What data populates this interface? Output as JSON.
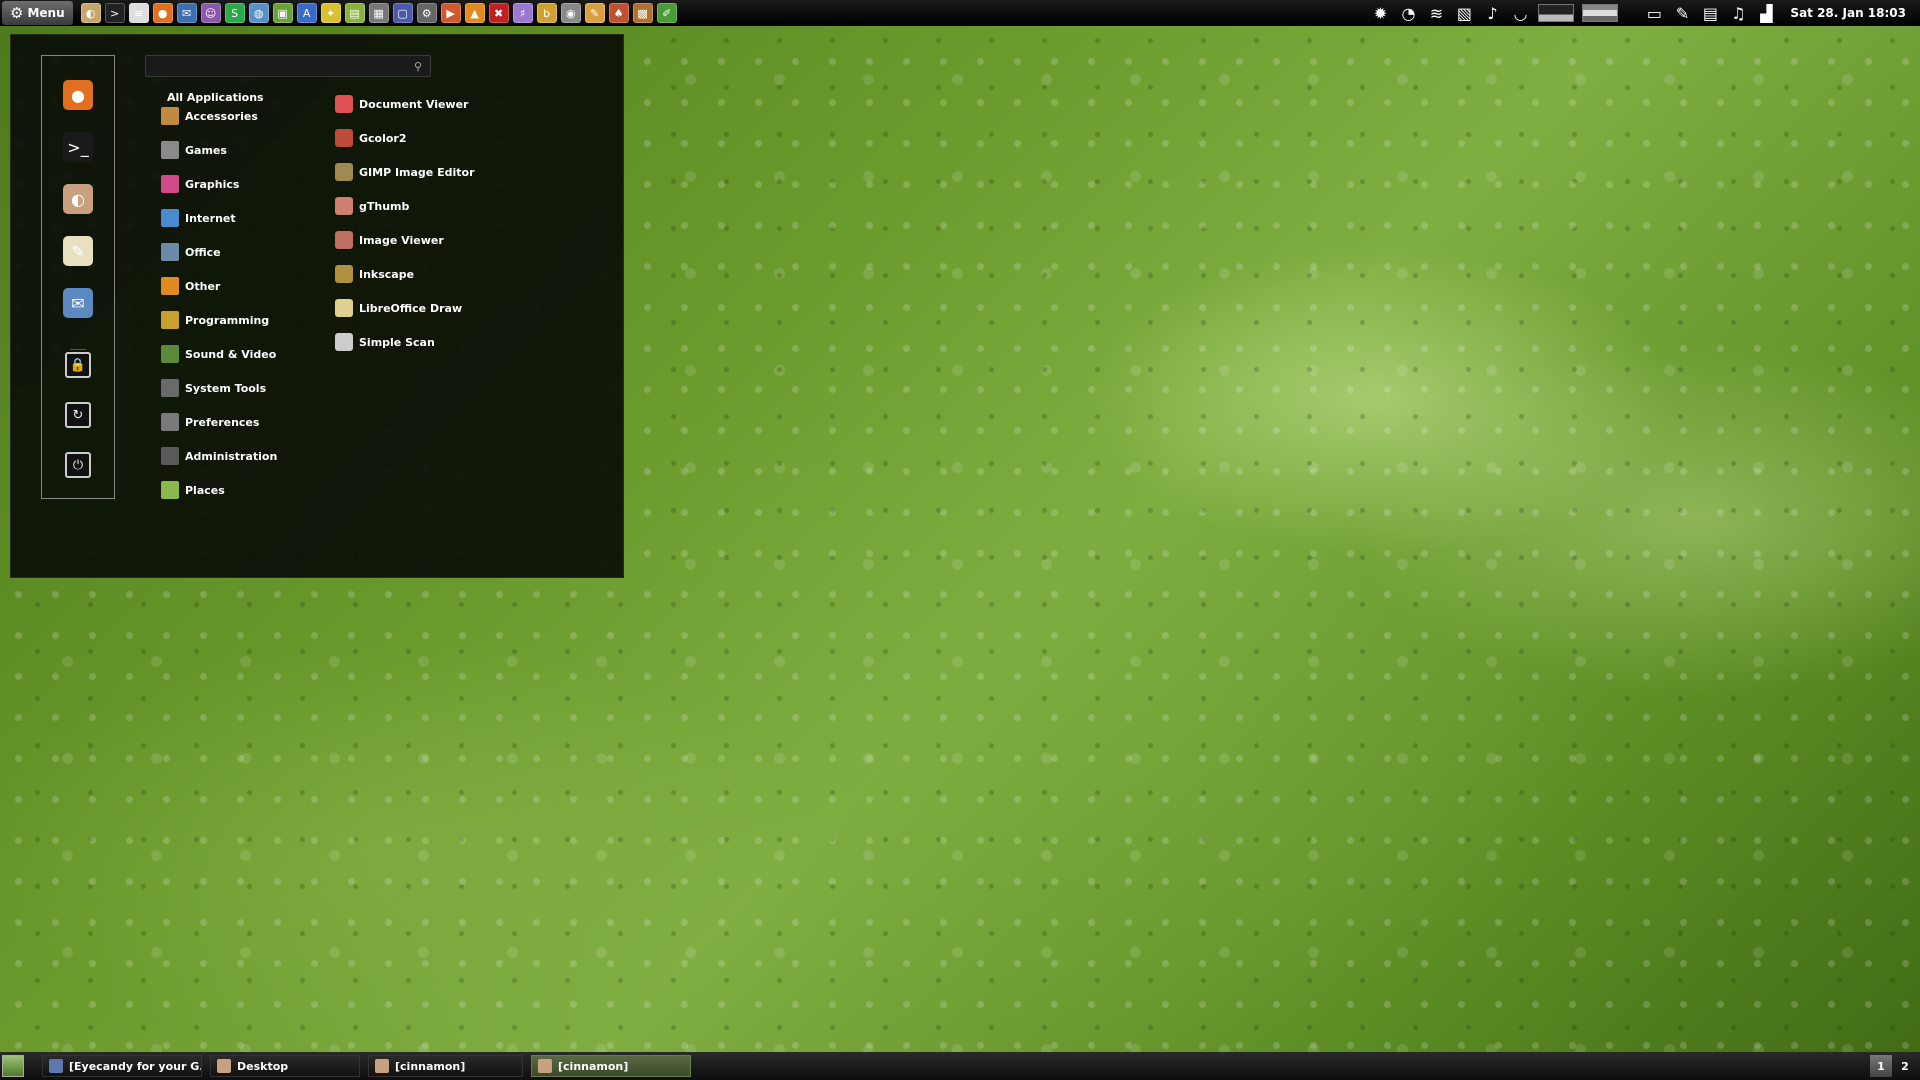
{
  "top_panel": {
    "menu_label": "Menu",
    "launchers": [
      {
        "icon": "file-manager-icon",
        "color": "#c9a66b",
        "glyph": "◐"
      },
      {
        "icon": "terminal-icon",
        "color": "#222222",
        "glyph": ">"
      },
      {
        "icon": "text-editor-icon",
        "color": "#dddddd",
        "glyph": "≡"
      },
      {
        "icon": "firefox-icon",
        "color": "#e07020",
        "glyph": "●"
      },
      {
        "icon": "thunderbird-icon",
        "color": "#3a6fb0",
        "glyph": "✉"
      },
      {
        "icon": "pidgin-icon",
        "color": "#8a5aa8",
        "glyph": "☺"
      },
      {
        "icon": "skype-icon",
        "color": "#2aa84a",
        "glyph": "S"
      },
      {
        "icon": "chat-icon",
        "color": "#5a8fc8",
        "glyph": "◍"
      },
      {
        "icon": "image-viewer-icon",
        "color": "#6aa03a",
        "glyph": "▣"
      },
      {
        "icon": "writer-icon",
        "color": "#3a6ac8",
        "glyph": "A"
      },
      {
        "icon": "star-icon",
        "color": "#d8c030",
        "glyph": "✦"
      },
      {
        "icon": "archive-icon",
        "color": "#8ab040",
        "glyph": "▤"
      },
      {
        "icon": "calculator-icon",
        "color": "#777777",
        "glyph": "▦"
      },
      {
        "icon": "monitor-icon",
        "color": "#4a5aa8",
        "glyph": "▢"
      },
      {
        "icon": "settings-icon",
        "color": "#666666",
        "glyph": "⚙"
      },
      {
        "icon": "media-player-icon",
        "color": "#d05a30",
        "glyph": "▶"
      },
      {
        "icon": "vlc-icon",
        "color": "#e08a20",
        "glyph": "▲"
      },
      {
        "icon": "video-editor-icon",
        "color": "#c02020",
        "glyph": "✖"
      },
      {
        "icon": "keyboard-icon",
        "color": "#9a7ad0",
        "glyph": "♯"
      },
      {
        "icon": "notes-icon",
        "color": "#d0a030",
        "glyph": "b"
      },
      {
        "icon": "eye-icon",
        "color": "#888888",
        "glyph": "◉"
      },
      {
        "icon": "gimp-icon",
        "color": "#d8a040",
        "glyph": "✎"
      },
      {
        "icon": "game-icon",
        "color": "#c05030",
        "glyph": "♠"
      },
      {
        "icon": "package-icon",
        "color": "#b07030",
        "glyph": "▩"
      },
      {
        "icon": "pen-icon",
        "color": "#4a9a3a",
        "glyph": "✐"
      }
    ],
    "tray": [
      {
        "icon": "gear-tray-icon",
        "glyph": "✹"
      },
      {
        "icon": "messenger-tray-icon",
        "glyph": "◔"
      },
      {
        "icon": "rss-tray-icon",
        "glyph": "≋"
      },
      {
        "icon": "feed-tray-icon",
        "glyph": "▧"
      },
      {
        "icon": "music-note-tray-icon",
        "glyph": "♪"
      },
      {
        "icon": "cup-tray-icon",
        "glyph": "◡"
      }
    ],
    "tray2": [
      {
        "icon": "window-tray-icon",
        "glyph": "▭"
      },
      {
        "icon": "edit-tray-icon",
        "glyph": "✎"
      },
      {
        "icon": "clipboard-tray-icon",
        "glyph": "▤"
      },
      {
        "icon": "music-tray-icon",
        "glyph": "♫"
      },
      {
        "icon": "signal-tray-icon",
        "glyph": "▟"
      }
    ],
    "clock": "Sat 28. Jan   18:03"
  },
  "menu": {
    "search_value": "",
    "favorites": [
      {
        "icon": "firefox-icon",
        "color": "#e07020",
        "glyph": "●"
      },
      {
        "icon": "terminal-icon",
        "color": "#1a1a1a",
        "glyph": ">_"
      },
      {
        "icon": "file-manager-icon",
        "color": "#c9a080",
        "glyph": "◐"
      },
      {
        "icon": "text-editor-icon",
        "color": "#e8e0c0",
        "glyph": "✎"
      },
      {
        "icon": "thunderbird-icon",
        "color": "#5a8ac0",
        "glyph": "✉"
      }
    ],
    "system_buttons": [
      {
        "icon": "lock-icon",
        "glyph": "🔒"
      },
      {
        "icon": "logout-icon",
        "glyph": "↻"
      },
      {
        "icon": "shutdown-icon",
        "glyph": "⏻"
      }
    ],
    "all_applications_label": "All Applications",
    "categories": [
      {
        "label": "Accessories",
        "color": "#c08a40"
      },
      {
        "label": "Games",
        "color": "#8a8a8a"
      },
      {
        "label": "Graphics",
        "color": "#d04a8a"
      },
      {
        "label": "Internet",
        "color": "#4a8ad0"
      },
      {
        "label": "Office",
        "color": "#6a8aa8"
      },
      {
        "label": "Other",
        "color": "#e08a20"
      },
      {
        "label": "Programming",
        "color": "#c8a030"
      },
      {
        "label": "Sound & Video",
        "color": "#5a8a3a"
      },
      {
        "label": "System Tools",
        "color": "#6a6a6a"
      },
      {
        "label": "Preferences",
        "color": "#7a7a7a"
      },
      {
        "label": "Administration",
        "color": "#5a5a5a"
      },
      {
        "label": "Places",
        "color": "#8ab84a"
      }
    ],
    "apps": [
      {
        "label": "Document Viewer",
        "color": "#e05050"
      },
      {
        "label": "Gcolor2",
        "color": "#c04a3a"
      },
      {
        "label": "GIMP Image Editor",
        "color": "#a08a50"
      },
      {
        "label": "gThumb",
        "color": "#d08070"
      },
      {
        "label": "Image Viewer",
        "color": "#c07060"
      },
      {
        "label": "Inkscape",
        "color": "#b09040"
      },
      {
        "label": "LibreOffice Draw",
        "color": "#e0d090"
      },
      {
        "label": "Simple Scan",
        "color": "#cccccc"
      }
    ]
  },
  "bottom_panel": {
    "tasks": [
      {
        "label": "[Eyecandy for your G...",
        "color": "#5a7ab0",
        "active": false
      },
      {
        "label": "Desktop",
        "color": "#c9a080",
        "active": false
      },
      {
        "label": "[cinnamon]",
        "color": "#c9a080",
        "active": false
      },
      {
        "label": "[cinnamon]",
        "color": "#c9a080",
        "active": true
      }
    ],
    "workspaces": [
      "1",
      "2"
    ],
    "active_workspace": "1"
  }
}
